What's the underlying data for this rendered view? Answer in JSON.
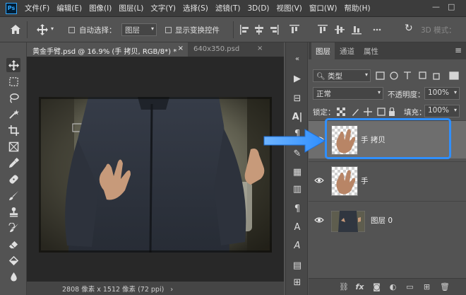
{
  "app": {
    "logo": "Ps"
  },
  "menu": [
    "文件(F)",
    "编辑(E)",
    "图像(I)",
    "图层(L)",
    "文字(Y)",
    "选择(S)",
    "滤镜(T)",
    "3D(D)",
    "视图(V)",
    "窗口(W)",
    "帮助(H)"
  ],
  "options": {
    "auto_select_label": "自动选择：",
    "auto_select_value": "图层",
    "show_transform_label": "显示变换控件",
    "mode_3d_label": "3D 模式："
  },
  "document": {
    "tabs": [
      {
        "label": "黄金手臂.psd @ 16.9% (手 拷贝, RGB/8*) *",
        "active": true
      },
      {
        "label": "640x350.psd",
        "active": false
      }
    ],
    "status": "2808 像素 x 1512 像素 (72 ppi)"
  },
  "layers_panel": {
    "tabs": [
      "图层",
      "通道",
      "属性"
    ],
    "filter_kind": "类型",
    "blend_mode": "正常",
    "opacity_label": "不透明度：",
    "opacity_value": "100%",
    "lock_label": "锁定：",
    "fill_label": "填充：",
    "fill_value": "100%",
    "layers": [
      {
        "name": "手 拷贝",
        "selected": true,
        "visible": true
      },
      {
        "name": "手",
        "selected": false,
        "visible": true
      },
      {
        "name": "图层 0",
        "selected": false,
        "visible": true
      }
    ],
    "bottom_icons": [
      "link-icon",
      "fx-icon",
      "mask-icon",
      "adjustment-icon",
      "group-icon",
      "new-layer-icon",
      "delete-icon"
    ],
    "bottom_labels": [
      "fx"
    ]
  },
  "annotation": {
    "color": "#2f8fff",
    "arrow": "right-arrow-icon"
  },
  "colors": {
    "accent": "#2f8fff",
    "bg_dark": "#282828",
    "panel": "#535353"
  }
}
